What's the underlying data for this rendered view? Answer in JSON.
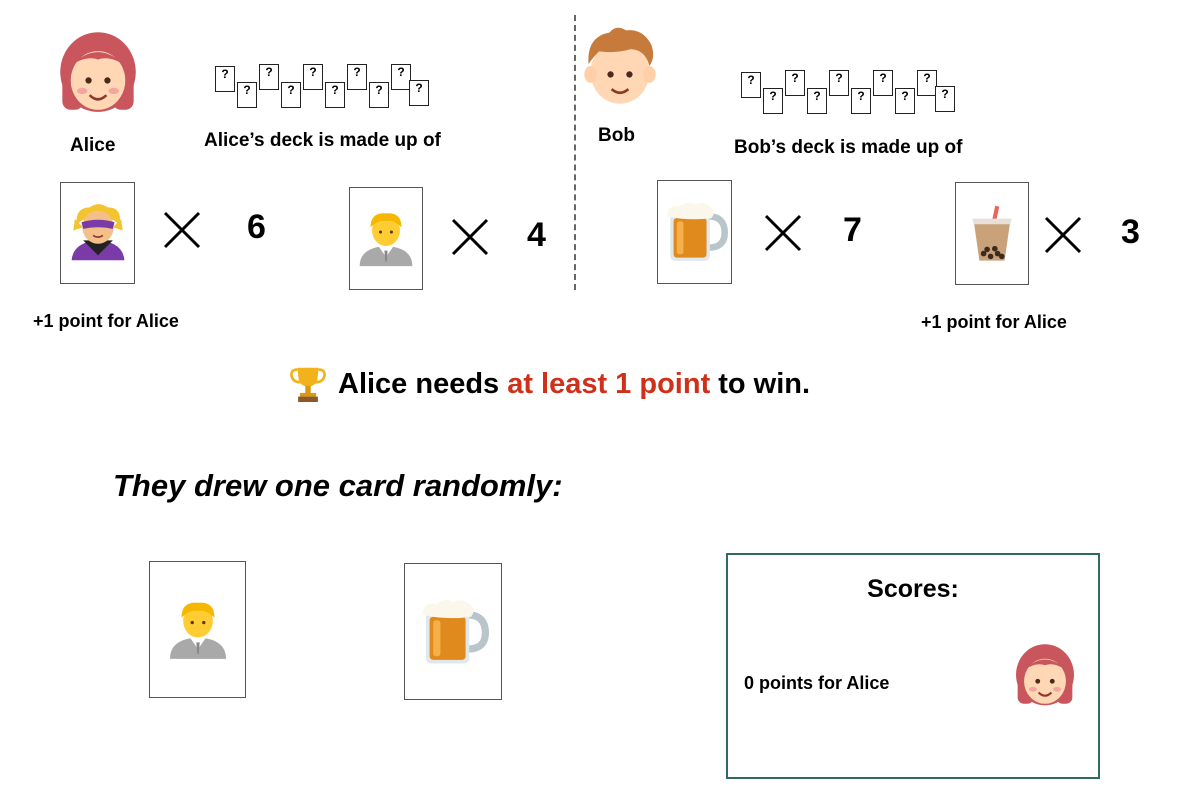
{
  "alice": {
    "name": "Alice",
    "deck_title": "Alice’s deck is made up of",
    "cards": [
      {
        "icon": "superhero-icon",
        "count": "6"
      },
      {
        "icon": "person-icon",
        "count": "4"
      }
    ],
    "point_label": "+1 point for Alice"
  },
  "bob": {
    "name": "Bob",
    "deck_title": "Bob’s deck is made up of",
    "cards": [
      {
        "icon": "beer-mug-icon",
        "count": "7"
      },
      {
        "icon": "bubble-tea-icon",
        "count": "3"
      }
    ],
    "point_label": "+1 point for Alice"
  },
  "mini_card_glyph": "?",
  "win_condition": {
    "prefix": "Alice needs",
    "highlight": "at least 1 point",
    "suffix": "to win.",
    "highlight_color": "#d0301a"
  },
  "draw": {
    "title": "They drew one card randomly:",
    "cards": [
      "person-icon",
      "beer-mug-icon"
    ]
  },
  "scores": {
    "title": "Scores:",
    "text": "0 points for Alice",
    "border_color": "#2f6b60"
  }
}
